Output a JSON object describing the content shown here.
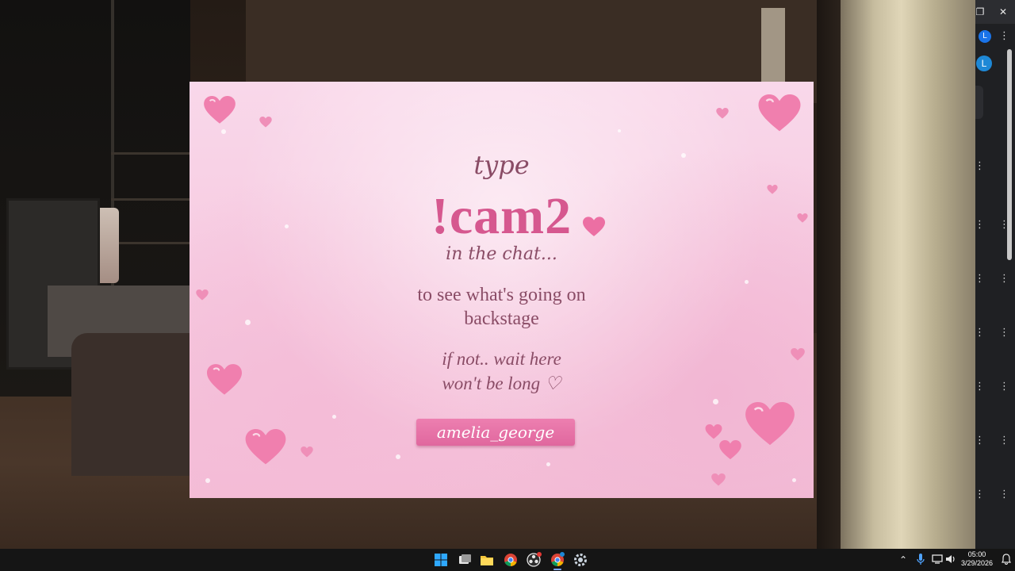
{
  "overlay": {
    "line_type": "type",
    "command": "!cam2",
    "line_chat": "in the chat...",
    "body_line1": "to see what's going on",
    "body_line2": "backstage",
    "wait_line1": "if not.. wait here",
    "wait_line2": "won't be long ♡",
    "username": "amelia_george"
  },
  "browser": {
    "profile_initial": "L"
  },
  "taskbar": {
    "icons": [
      "windows-start-icon",
      "task-view-icon",
      "file-explorer-icon",
      "chrome-icon",
      "obs-icon",
      "chrome-profile-icon",
      "settings-icon"
    ],
    "clock_time": "05:00",
    "clock_date": "3/29/2026"
  },
  "colors": {
    "accent_pink": "#d6588f",
    "text_mauve": "#8a4c66",
    "tag_pink": "#e0679e"
  }
}
